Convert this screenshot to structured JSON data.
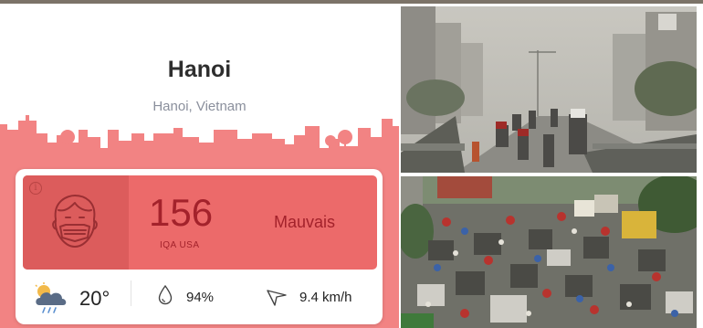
{
  "city": {
    "name": "Hanoi",
    "location": "Hanoi, Vietnam"
  },
  "aqi": {
    "value": "156",
    "unit": "IQA USA",
    "level": "Mauvais",
    "info_icon": "info-icon",
    "face_icon": "face-mask-icon",
    "color": "#ec6a6a",
    "text_color": "#a3222b"
  },
  "weather": {
    "icon": "cloud-rain-icon",
    "temperature": "20°",
    "humidity_icon": "droplet-icon",
    "humidity": "94%",
    "wind_icon": "wind-direction-icon",
    "wind_speed": "9.4 km/h"
  },
  "colors": {
    "skyline": "#f28383",
    "skyline_light": "#fbe3e3"
  }
}
